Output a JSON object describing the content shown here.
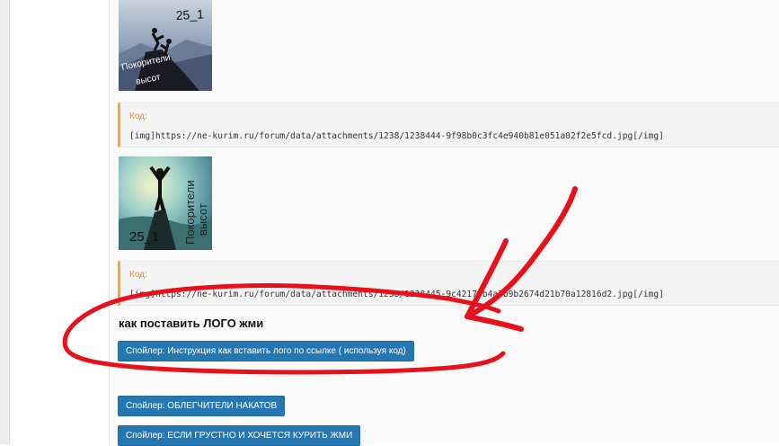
{
  "posts": {
    "image1": {
      "caption_num": "25_1",
      "caption_line1": "Покорители",
      "caption_line2": "высот"
    },
    "code1": {
      "label": "Код:",
      "text": "[img]https://ne-kurim.ru/forum/data/attachments/1238/1238444-9f98b0c3fc4e940b81e051a02f2e5fcd.jpg[/img]"
    },
    "image2": {
      "caption_num": "25_1",
      "caption_line1": "Покорители",
      "caption_line2": "высот"
    },
    "code2": {
      "label": "Код:",
      "text": "[img]https://ne-kurim.ru/forum/data/attachments/1238/1238445-9c42170b4a3b9b2674d21b70a12816d2.jpg[/img]"
    }
  },
  "heading": "как поставить ЛОГО жми",
  "spoilers": [
    "Спойлер: Инструкция как вставить лого по ссылке ( используя код)",
    "Спойлер: ОБЛЕГЧИТЕЛИ НАКАТОВ",
    "Спойлер: ЕСЛИ ГРУСТНО И ХОЧЕТСЯ КУРИТЬ ЖМИ"
  ],
  "colors": {
    "annotation": "#e8101a",
    "button": "#2577b1",
    "code_accent": "#f3a833"
  }
}
